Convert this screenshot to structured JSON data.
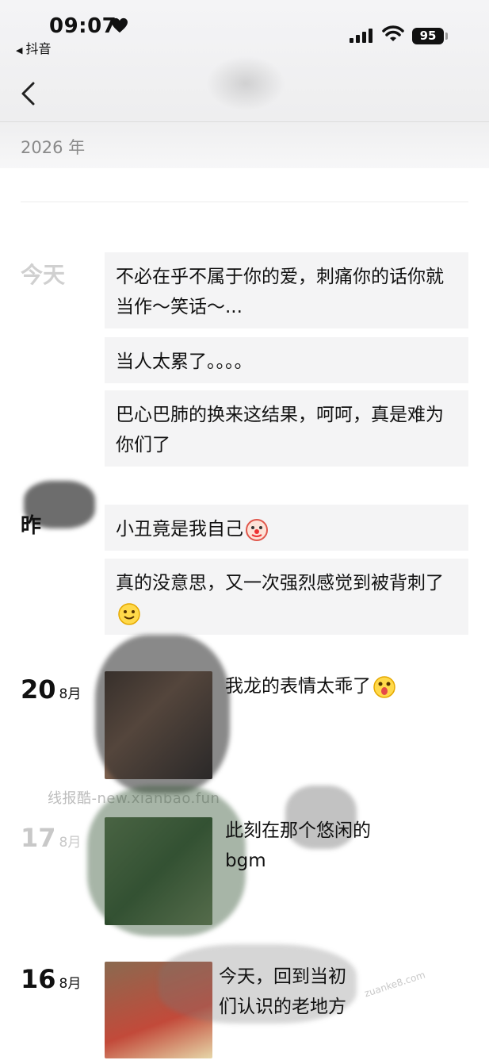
{
  "status_bar": {
    "time": "09:07",
    "back_app": "抖音",
    "battery": "95"
  },
  "header": {
    "year": "2026 年"
  },
  "timeline": {
    "today_label": "今天",
    "today_posts": [
      "不必在乎不属于你的爱，刺痛你的话你就当作～笑话～...",
      "当人太累了。。。。",
      "巴心巴肺的换来这结果，呵呵，真是难为你们了"
    ],
    "yesterday_label": "昨",
    "yesterday_posts": [
      "小丑竟是我自己",
      "真的没意思，又一次强烈感觉到被背刺了"
    ],
    "entry_20": {
      "day": "20",
      "month": "8月",
      "text": "我龙的表情太乖了"
    },
    "entry_17": {
      "day": "17",
      "month": "8月",
      "text_line1": "此刻在那个悠闲的",
      "text_line2": "bgm"
    },
    "entry_16": {
      "day": "16",
      "month": "8月",
      "text_line1": "今天，回到当初",
      "text_line2": "们认识的老地方"
    }
  },
  "watermark": "线报酷-new.xianbao.fun",
  "corner_watermark": "zuanke8.com"
}
